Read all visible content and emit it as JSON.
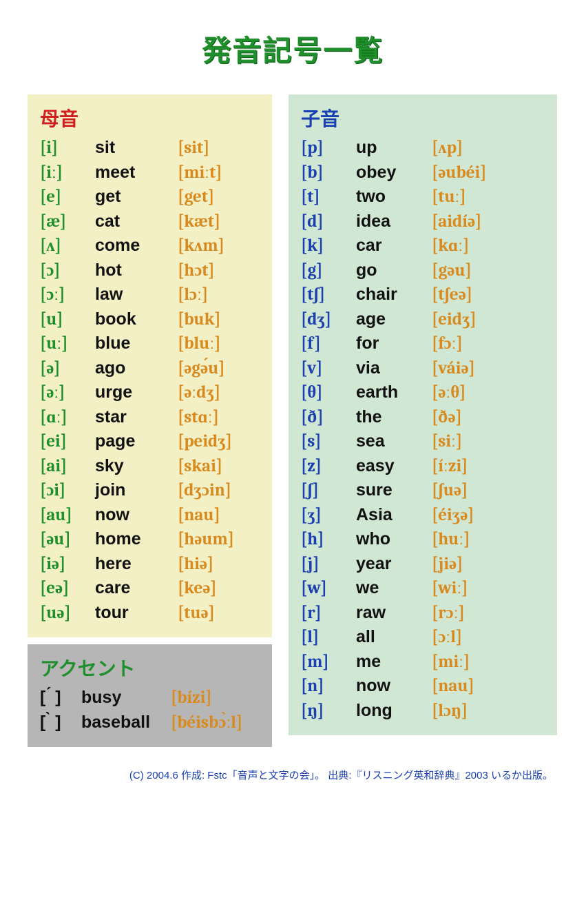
{
  "title": "発音記号一覧",
  "vowels_header": "母音",
  "consonants_header": "子音",
  "accent_header": "アクセント",
  "vowels": [
    {
      "sym": "[i]",
      "word": "sit",
      "pron": "[sit]"
    },
    {
      "sym": "[iː]",
      "word": "meet",
      "pron": "[miːt]"
    },
    {
      "sym": "[e]",
      "word": "get",
      "pron": "[get]"
    },
    {
      "sym": "[æ]",
      "word": "cat",
      "pron": "[kæt]"
    },
    {
      "sym": "[ʌ]",
      "word": "come",
      "pron": "[kʌm]"
    },
    {
      "sym": "[ɔ]",
      "word": "hot",
      "pron": "[hɔt]"
    },
    {
      "sym": "[ɔː]",
      "word": "law",
      "pron": "[lɔː]"
    },
    {
      "sym": "[u]",
      "word": "book",
      "pron": "[buk]"
    },
    {
      "sym": "[uː]",
      "word": "blue",
      "pron": "[bluː]"
    },
    {
      "sym": "[ə]",
      "word": "ago",
      "pron": "[əgə́u]"
    },
    {
      "sym": "[əː]",
      "word": "urge",
      "pron": "[əːdʒ]"
    },
    {
      "sym": "[ɑː]",
      "word": "star",
      "pron": "[stɑː]"
    },
    {
      "sym": "[ei]",
      "word": "page",
      "pron": "[peidʒ]"
    },
    {
      "sym": "[ai]",
      "word": "sky",
      "pron": "[skai]"
    },
    {
      "sym": "[ɔi]",
      "word": "join",
      "pron": "[dʒɔin]"
    },
    {
      "sym": "[au]",
      "word": "now",
      "pron": "[nau]"
    },
    {
      "sym": "[əu]",
      "word": "home",
      "pron": "[həum]"
    },
    {
      "sym": "[iə]",
      "word": "here",
      "pron": "[hiə]"
    },
    {
      "sym": "[eə]",
      "word": "care",
      "pron": "[keə]"
    },
    {
      "sym": "[uə]",
      "word": "tour",
      "pron": "[tuə]"
    }
  ],
  "accents": [
    {
      "sym": "[ ́ ]",
      "word": "busy",
      "pron": "[bízi]"
    },
    {
      "sym": "[ ̀ ]",
      "word": "baseball",
      "pron": "[béisbɔ̀ːl]"
    }
  ],
  "consonants": [
    {
      "sym": "[p]",
      "word": "up",
      "pron": "[ʌp]"
    },
    {
      "sym": "[b]",
      "word": "obey",
      "pron": "[əubéi]"
    },
    {
      "sym": "[t]",
      "word": "two",
      "pron": "[tuː]"
    },
    {
      "sym": "[d]",
      "word": "idea",
      "pron": "[aidíə]"
    },
    {
      "sym": "[k]",
      "word": "car",
      "pron": "[kɑː]"
    },
    {
      "sym": "[g]",
      "word": "go",
      "pron": "[gəu]"
    },
    {
      "sym": "[tʃ]",
      "word": "chair",
      "pron": "[tʃeə]"
    },
    {
      "sym": "[dʒ]",
      "word": "age",
      "pron": "[eidʒ]"
    },
    {
      "sym": "[f]",
      "word": "for",
      "pron": "[fɔː]"
    },
    {
      "sym": "[v]",
      "word": "via",
      "pron": "[váiə]"
    },
    {
      "sym": "[θ]",
      "word": "earth",
      "pron": "[əːθ]"
    },
    {
      "sym": "[ð]",
      "word": "the",
      "pron": "[ðə]"
    },
    {
      "sym": "[s]",
      "word": "sea",
      "pron": "[siː]"
    },
    {
      "sym": "[z]",
      "word": "easy",
      "pron": "[íːzi]"
    },
    {
      "sym": "[ʃ]",
      "word": "sure",
      "pron": "[ʃuə]"
    },
    {
      "sym": "[ʒ]",
      "word": "Asia",
      "pron": "[éiʒə]"
    },
    {
      "sym": "[h]",
      "word": "who",
      "pron": "[huː]"
    },
    {
      "sym": "[j]",
      "word": "year",
      "pron": "[jiə]"
    },
    {
      "sym": "[w]",
      "word": "we",
      "pron": "[wiː]"
    },
    {
      "sym": "[r]",
      "word": "raw",
      "pron": "[rɔː]"
    },
    {
      "sym": "[l]",
      "word": "all",
      "pron": "[ɔːl]"
    },
    {
      "sym": "[m]",
      "word": "me",
      "pron": "[miː]"
    },
    {
      "sym": "[n]",
      "word": "now",
      "pron": "[nau]"
    },
    {
      "sym": "[ŋ]",
      "word": "long",
      "pron": "[lɔŋ]"
    }
  ],
  "footer": "(C) 2004.6 作成: Fstc「音声と文字の会」。 出典:『リスニング英和辞典』2003 いるか出版。"
}
